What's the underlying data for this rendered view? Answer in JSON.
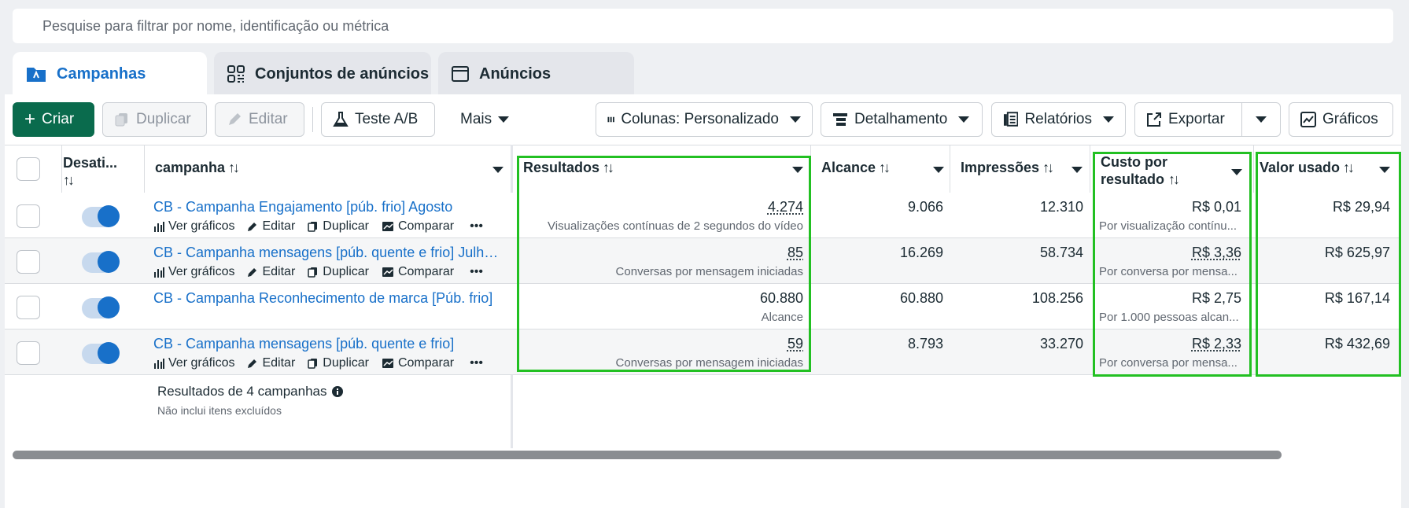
{
  "search": {
    "placeholder": "Pesquise para filtrar por nome, identificação ou métrica"
  },
  "tabs": [
    {
      "label": "Campanhas",
      "icon": "folder-icon",
      "active": true
    },
    {
      "label": "Conjuntos de anúncios",
      "icon": "grid-icon",
      "active": false
    },
    {
      "label": "Anúncios",
      "icon": "window-icon",
      "active": false
    }
  ],
  "toolbar": {
    "create": "Criar",
    "duplicate": "Duplicar",
    "edit": "Editar",
    "ab_test": "Teste A/B",
    "more": "Mais",
    "columns": "Colunas: Personalizado",
    "breakdown": "Detalhamento",
    "reports": "Relatórios",
    "export": "Exportar",
    "charts": "Gráficos"
  },
  "columns": {
    "toggle": "Desati...",
    "campaign": "campanha",
    "results": "Resultados",
    "reach": "Alcance",
    "impressions": "Impressões",
    "cost_line1": "Custo por",
    "cost_line2": "resultado",
    "spent": "Valor usado"
  },
  "row_actions": {
    "charts": "Ver gráficos",
    "edit": "Editar",
    "duplicate": "Duplicar",
    "compare": "Comparar",
    "more": "•••"
  },
  "rows": [
    {
      "name": "CB - Campanha Engajamento [púb. frio] Agosto",
      "results": "4.274",
      "results_type": "Visualizações contínuas de 2 segundos do vídeo",
      "reach": "9.066",
      "impressions": "12.310",
      "cost": "R$ 0,01",
      "cost_type": "Por visualização contínu...",
      "spent": "R$ 29,94"
    },
    {
      "name": "CB - Campanha mensagens [púb. quente e frio] Julho...",
      "results": "85",
      "results_type": "Conversas por mensagem iniciadas",
      "reach": "16.269",
      "impressions": "58.734",
      "cost": "R$ 3,36",
      "cost_type": "Por conversa por mensa...",
      "spent": "R$ 625,97"
    },
    {
      "name": "CB - Campanha Reconhecimento de marca [Púb. frio]",
      "results": "60.880",
      "results_type": "Alcance",
      "reach": "60.880",
      "impressions": "108.256",
      "cost": "R$ 2,75",
      "cost_type": "Por 1.000 pessoas alcan...",
      "spent": "R$ 167,14"
    },
    {
      "name": "CB - Campanha mensagens [púb. quente e frio]",
      "results": "59",
      "results_type": "Conversas por mensagem iniciadas",
      "reach": "8.793",
      "impressions": "33.270",
      "cost": "R$ 2,33",
      "cost_type": "Por conversa por mensa...",
      "spent": "R$ 432,69"
    }
  ],
  "footer": {
    "title": "Resultados de 4 campanhas",
    "subtitle": "Não inclui itens excluídos"
  },
  "colors": {
    "accent": "#1870c9",
    "create": "#0a6b4d",
    "highlight": "#22c022"
  }
}
